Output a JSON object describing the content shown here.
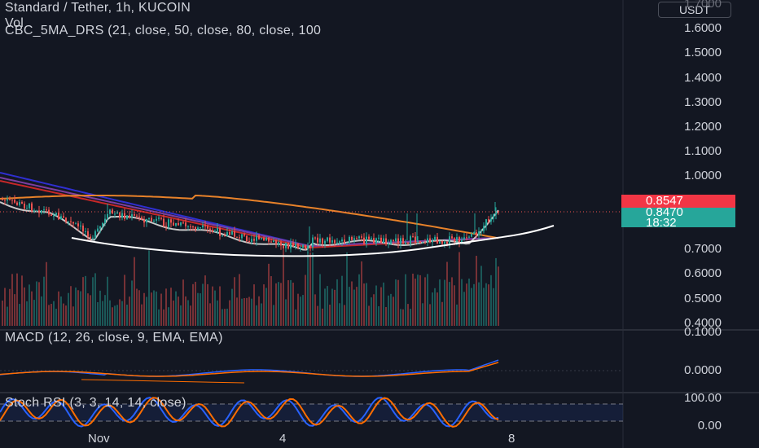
{
  "header": {
    "symbol_line": "Standard / Tether, 1h, KUCOIN",
    "indicator_line": "CBC_5MA_DRS (21, close, 50, close, 80, close, 100",
    "vol_label": "Vol",
    "macd_label": "MACD (12, 26, close, 9, EMA, EMA)",
    "stoch_label": "Stoch RSI (3, 3, 14, 14, close)"
  },
  "currency_button": "USDT",
  "price_axis": [
    "1.7000",
    "1.6000",
    "1.5000",
    "1.4000",
    "1.3000",
    "1.2000",
    "1.1000",
    "1.0000",
    "0.7000",
    "0.6000",
    "0.5000",
    "0.4000"
  ],
  "macd_axis": [
    "0.1000",
    "0.0000"
  ],
  "stoch_axis": [
    "100.00",
    "0.00"
  ],
  "time_axis": [
    "Nov",
    "4",
    "8"
  ],
  "badges": {
    "current_price": "0.8547",
    "last_price": "0.8470",
    "countdown": "18:32"
  },
  "colors": {
    "background": "#131722",
    "up": "#26a69a",
    "down": "#ef5350",
    "ma_blue": "#2f2fd0",
    "ma_red": "#c62828",
    "ma_purple": "#7b3fa0",
    "ma_orange": "#e8822a",
    "ma_grey": "#c8c8c8",
    "macd_line": "#2962ff",
    "signal_line": "#ff6d00",
    "stoch_k": "#2962ff",
    "stoch_d": "#ff6d00"
  },
  "chart_data": {
    "type": "candlestick",
    "instrument": "Standard / Tether",
    "interval": "1h",
    "exchange": "KUCOIN",
    "price_range": [
      0.4,
      1.7
    ],
    "current_price": 0.8547,
    "last_price": 0.847,
    "macd_range": [
      -0.03,
      0.1
    ],
    "stoch_range": [
      0,
      100
    ],
    "stoch_levels": [
      80,
      20
    ]
  }
}
